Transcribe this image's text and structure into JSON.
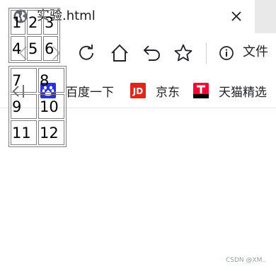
{
  "tab": {
    "title": "实验.html",
    "icon": "globe-icon"
  },
  "toolbar": {
    "info_label": "文件"
  },
  "bookmarks": [
    {
      "label": "百度一下",
      "icon": "baidu-paw-icon",
      "color": "#2932e1"
    },
    {
      "label": "京东",
      "icon": "jd-logo-icon",
      "color": "#e1251b"
    },
    {
      "label": "天猫精选",
      "icon": "tmall-logo-icon",
      "color": "#ff0036"
    }
  ],
  "table1": {
    "rows": [
      [
        "1",
        "2",
        "3"
      ],
      [
        "4",
        "5",
        "6"
      ]
    ]
  },
  "table2": {
    "rows": [
      [
        "7",
        "8"
      ],
      [
        "9",
        "10"
      ],
      [
        "11",
        "12"
      ]
    ]
  },
  "watermark": "CSDN @XM.."
}
